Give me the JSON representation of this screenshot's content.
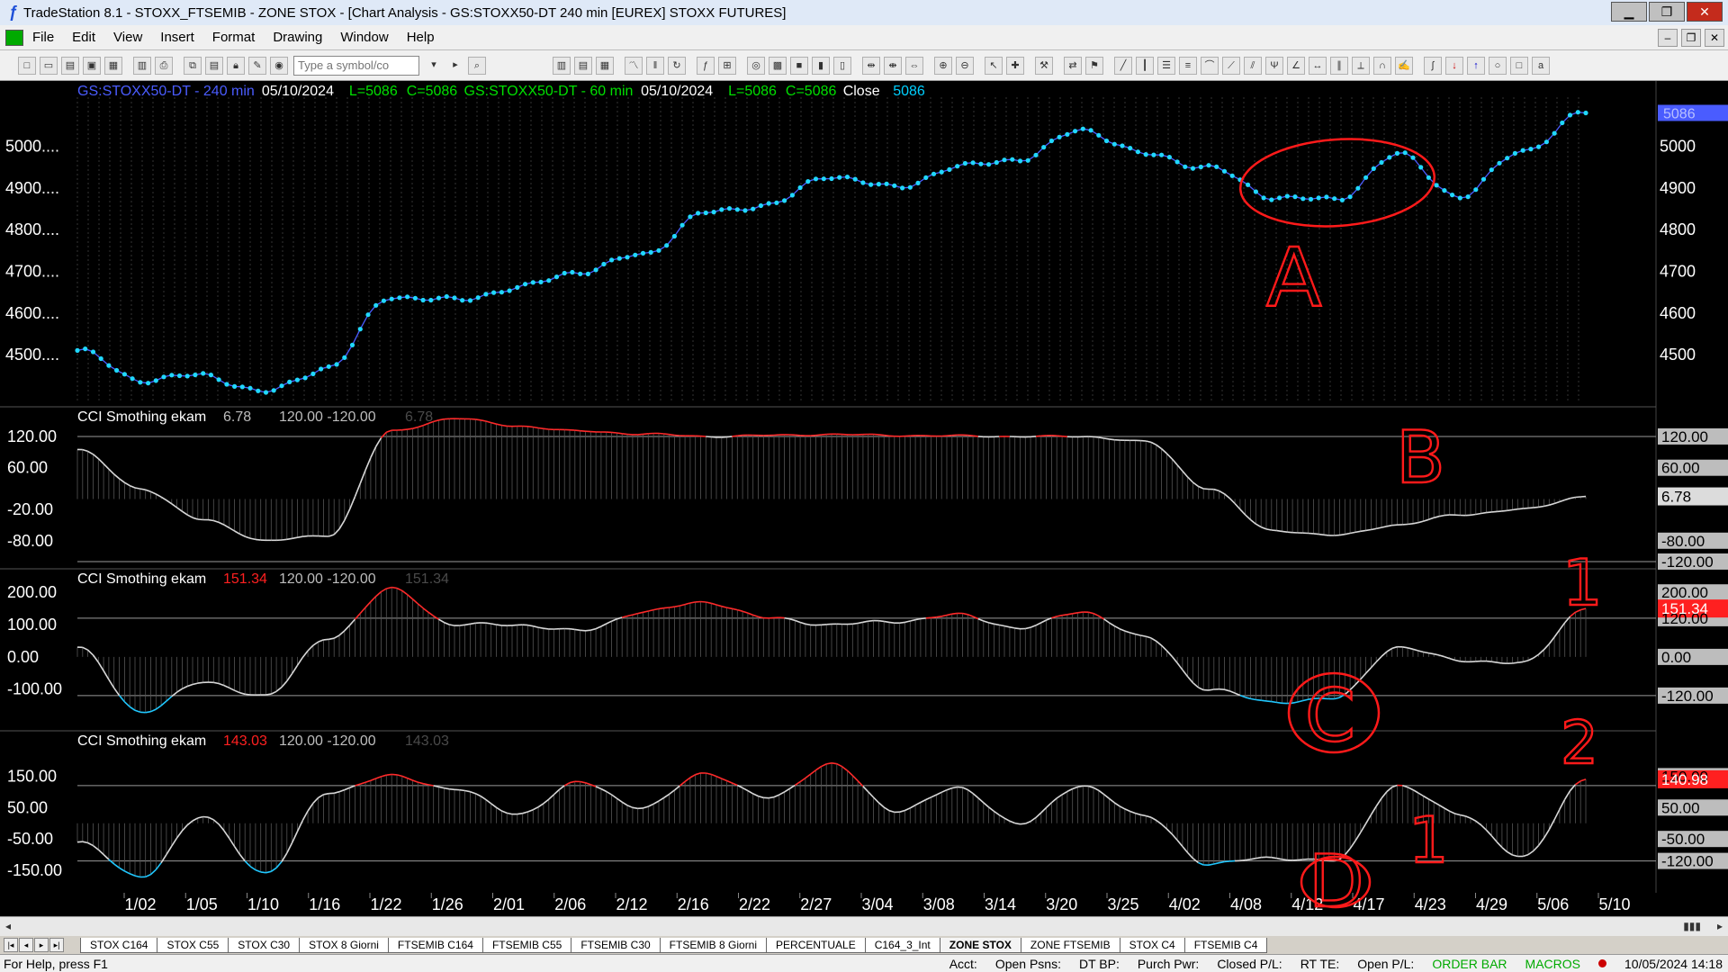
{
  "window": {
    "title": "TradeStation 8.1 - STOXX_FTSEMIB - ZONE STOX - [Chart Analysis - GS:STOXX50-DT  240 min  [EUREX] STOXX FUTURES]"
  },
  "menu": [
    "File",
    "Edit",
    "View",
    "Insert",
    "Format",
    "Drawing",
    "Window",
    "Help"
  ],
  "toolbar": {
    "symbol_placeholder": "Type a symbol/co"
  },
  "price_panel": {
    "header": [
      {
        "text": "GS:STOXX50-DT - 240 min",
        "color": "#4a5cff"
      },
      {
        "text": "05/10/2024",
        "color": "#ffffff"
      },
      {
        "text": "L=5086",
        "color": "#00e000"
      },
      {
        "text": "C=5086",
        "color": "#00e000"
      },
      {
        "text": "GS:STOXX50-DT - 60 min",
        "color": "#00e000"
      },
      {
        "text": "05/10/2024",
        "color": "#ffffff"
      },
      {
        "text": "L=5086",
        "color": "#00e000"
      },
      {
        "text": "C=5086",
        "color": "#00e000"
      },
      {
        "text": "Close",
        "color": "#ffffff"
      },
      {
        "text": "5086",
        "color": "#00d0ff"
      }
    ],
    "left_ticks": [
      "5000....",
      "4900....",
      "4800....",
      "4700....",
      "4600....",
      "4500...."
    ],
    "right_ticks": [
      "5000",
      "4900",
      "4800",
      "4700",
      "4600",
      "4500"
    ],
    "tick_values": [
      5000,
      4900,
      4800,
      4700,
      4600,
      4500
    ],
    "last_value_label": "5086",
    "ylim": [
      4390,
      5135
    ]
  },
  "cci_panels": [
    {
      "label": "CCI Smothing ekam",
      "value": "6.78",
      "value_color": "#bdbdbd",
      "bands": "120.00 -120.00",
      "ghost": "6.78",
      "left_ticks": [
        "120.00",
        "60.00",
        "-20.00",
        "-80.00"
      ],
      "tick_values": [
        120,
        60,
        -20,
        -80
      ],
      "right_ticks": [
        "120.00",
        "60.00",
        "-80.00",
        "-120.00"
      ],
      "right_values": [
        120,
        60,
        -80,
        -120
      ],
      "current_label": "6.78",
      "current_bg": "#dcdcdc",
      "current_fg": "#000000",
      "ylim": [
        -127,
        170
      ]
    },
    {
      "label": "CCI Smothing ekam",
      "value": "151.34",
      "value_color": "#ff2020",
      "bands": "120.00 -120.00",
      "ghost": "151.34",
      "left_ticks": [
        "200.00",
        "100.00",
        "0.00",
        "-100.00"
      ],
      "tick_values": [
        200,
        100,
        0,
        -100
      ],
      "right_ticks": [
        "200.00",
        "120.00",
        "0.00",
        "-120.00"
      ],
      "right_values": [
        200,
        120,
        0,
        -120
      ],
      "current_label": "151.34",
      "current_bg": "#ff2020",
      "current_fg": "#ffffff",
      "ylim": [
        -218,
        262
      ]
    },
    {
      "label": "CCI Smothing ekam",
      "value": "143.03",
      "value_color": "#ff2020",
      "bands": "120.00 -120.00",
      "ghost": "143.03",
      "left_ticks": [
        "150.00",
        "50.00",
        "-50.00",
        "-150.00"
      ],
      "tick_values": [
        150,
        50,
        -50,
        -150
      ],
      "right_ticks": [
        "150.00",
        "50.00",
        "-50.00",
        "-120.00"
      ],
      "right_values": [
        150,
        50,
        -50,
        -120
      ],
      "current_label": "140.98",
      "current_bg": "#ff2020",
      "current_fg": "#ffffff",
      "ylim": [
        -210,
        283
      ]
    }
  ],
  "x_axis": [
    "1/02",
    "1/05",
    "1/10",
    "1/16",
    "1/22",
    "1/26",
    "2/01",
    "2/06",
    "2/12",
    "2/16",
    "2/22",
    "2/27",
    "3/04",
    "3/08",
    "3/14",
    "3/20",
    "3/25",
    "4/02",
    "4/08",
    "4/12",
    "4/17",
    "4/23",
    "4/29",
    "5/06",
    "5/10"
  ],
  "chart_data": {
    "type": "line",
    "categories": [
      "1/02",
      "1/05",
      "1/10",
      "1/16",
      "1/22",
      "1/26",
      "2/01",
      "2/06",
      "2/12",
      "2/16",
      "2/22",
      "2/27",
      "3/04",
      "3/08",
      "3/14",
      "3/20",
      "3/25",
      "4/02",
      "4/08",
      "4/12",
      "4/17",
      "4/23",
      "4/29",
      "5/06",
      "5/10"
    ],
    "series": [
      {
        "name": "Close",
        "values": [
          4510,
          4440,
          4450,
          4410,
          4470,
          4640,
          4630,
          4660,
          4700,
          4740,
          4840,
          4860,
          4930,
          4900,
          4950,
          4970,
          5040,
          4980,
          4950,
          4880,
          4870,
          4980,
          4880,
          4990,
          5080
        ]
      },
      {
        "values": [
          95,
          20,
          -40,
          -80,
          -70,
          130,
          155,
          140,
          130,
          125,
          120,
          122,
          124,
          122,
          121,
          120,
          120,
          110,
          20,
          -60,
          -70,
          -50,
          -30,
          -20,
          5
        ]
      },
      {
        "values": [
          30,
          -170,
          -80,
          -120,
          60,
          210,
          100,
          100,
          80,
          140,
          170,
          120,
          100,
          110,
          130,
          90,
          140,
          60,
          -100,
          -140,
          -130,
          30,
          -10,
          -20,
          150
        ]
      },
      {
        "values": [
          -60,
          -170,
          20,
          -160,
          100,
          150,
          110,
          30,
          130,
          50,
          160,
          80,
          190,
          40,
          110,
          0,
          120,
          20,
          -130,
          -110,
          -120,
          120,
          30,
          -110,
          140
        ]
      }
    ]
  },
  "annotations": [
    "A",
    "B",
    "1",
    "C",
    "D",
    "1",
    "2"
  ],
  "tabs": [
    "STOX C164",
    "STOX C55",
    "STOX  C30",
    "STOX  8 Giorni",
    "FTSEMIB C164",
    "FTSEMIB C55",
    "FTSEMIB C30",
    "FTSEMIB  8 Giorni",
    "PERCENTUALE",
    "C164_3_Int",
    "ZONE STOX",
    "ZONE FTSEMIB",
    "STOX  C4",
    "FTSEMIB C4"
  ],
  "active_tab": "ZONE STOX",
  "status": {
    "help": "For Help, press F1",
    "fields": [
      "Acct:",
      "Open Psns:",
      "DT BP:",
      "Purch Pwr:",
      "Closed P/L:",
      "RT TE:",
      "Open P/L:"
    ],
    "order_bar": "ORDER BAR",
    "macros": "MACROS",
    "datetime": "10/05/2024 14:18"
  }
}
